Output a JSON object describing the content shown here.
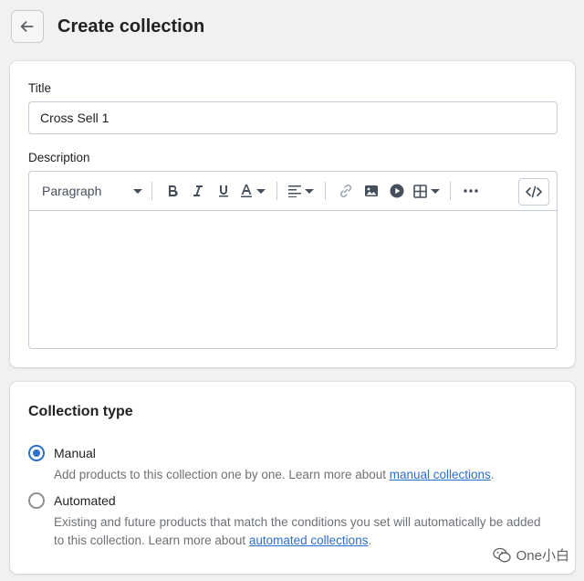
{
  "header": {
    "title": "Create collection"
  },
  "title_field": {
    "label": "Title",
    "value": "Cross Sell 1"
  },
  "description": {
    "label": "Description",
    "toolbar": {
      "paragraph_label": "Paragraph",
      "icons": [
        "bold-icon",
        "italic-icon",
        "underline-icon",
        "text-color-icon",
        "align-icon",
        "link-icon",
        "image-icon",
        "video-icon",
        "table-icon",
        "more-icon",
        "code-icon"
      ]
    },
    "content": ""
  },
  "collection_type": {
    "title": "Collection type",
    "options": [
      {
        "label": "Manual",
        "checked": true,
        "help_prefix": "Add products to this collection one by one. Learn more about ",
        "help_link": "manual collections",
        "help_suffix": "."
      },
      {
        "label": "Automated",
        "checked": false,
        "help_prefix": "Existing and future products that match the conditions you set will automatically be added to this collection. Learn more about ",
        "help_link": "automated collections",
        "help_suffix": "."
      }
    ]
  },
  "watermark": {
    "text": "One小白"
  },
  "colors": {
    "accent": "#2c6ecb",
    "background": "#f1f1f1",
    "text": "#202223",
    "subdued": "#6d7175"
  }
}
